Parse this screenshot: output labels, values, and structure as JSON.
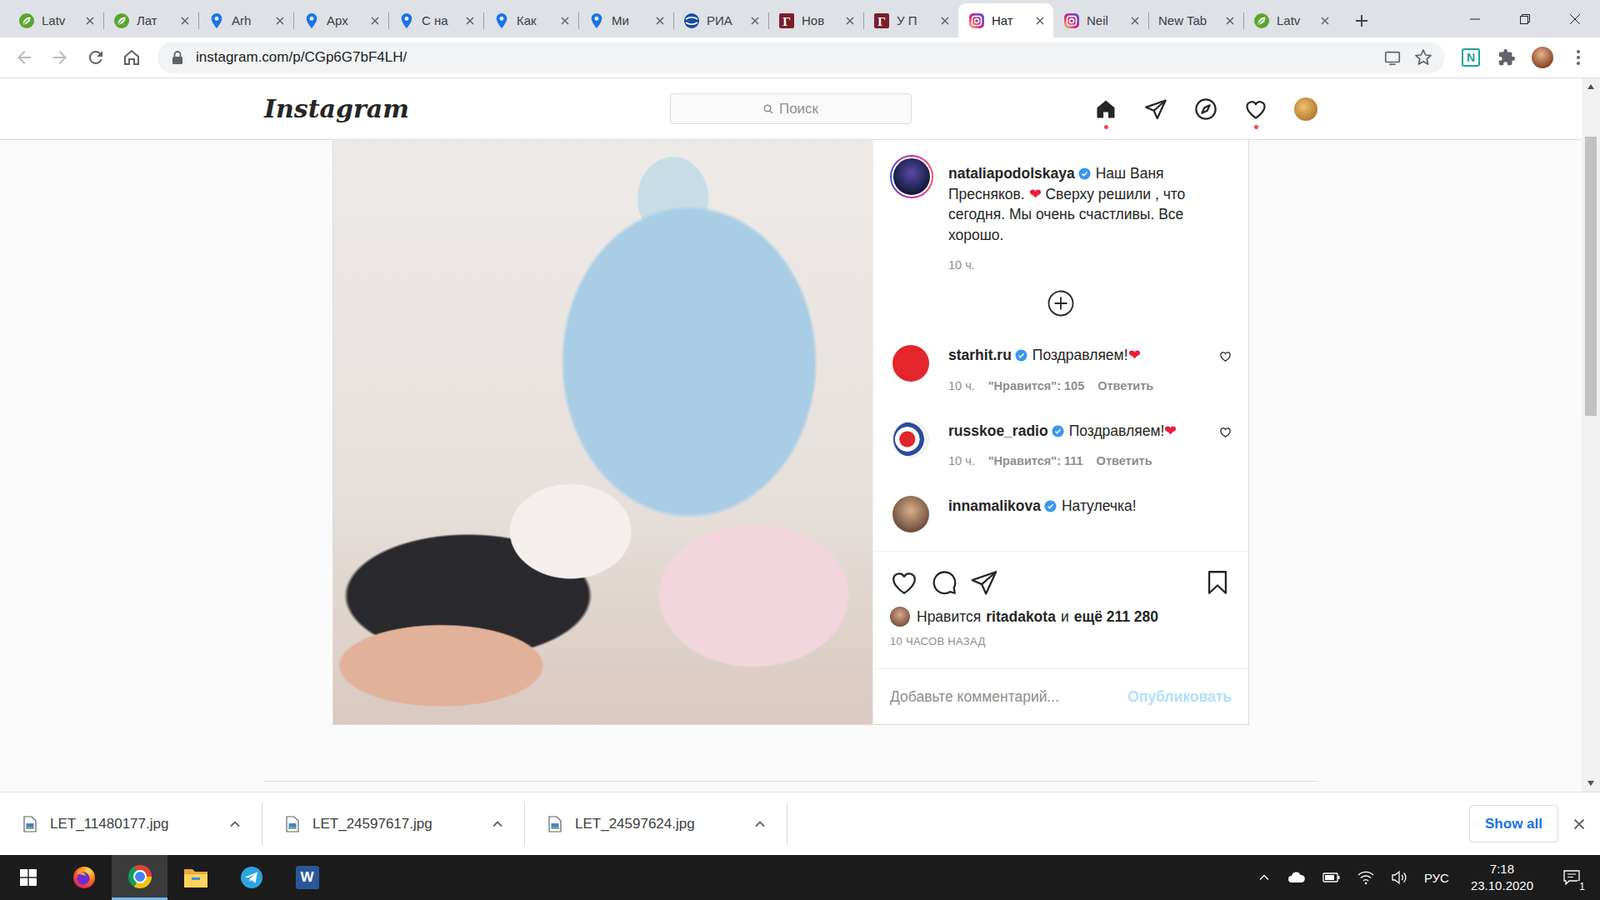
{
  "browser": {
    "tabs": [
      {
        "label": "Latv",
        "kind": "leaf",
        "selected": false
      },
      {
        "label": "Лат",
        "kind": "leaf",
        "selected": false
      },
      {
        "label": "Arh",
        "kind": "pin",
        "selected": false
      },
      {
        "label": "Арх",
        "kind": "pin",
        "selected": false
      },
      {
        "label": "С на",
        "kind": "pin",
        "selected": false
      },
      {
        "label": "Как",
        "kind": "pin",
        "selected": false
      },
      {
        "label": "Ми",
        "kind": "pin",
        "selected": false
      },
      {
        "label": "РИА",
        "kind": "ria",
        "selected": false
      },
      {
        "label": "Нов",
        "kind": "letter",
        "favicon_text": "Г",
        "selected": false
      },
      {
        "label": "У П",
        "kind": "letter",
        "favicon_text": "Г",
        "selected": false
      },
      {
        "label": "Нат",
        "kind": "instagram",
        "selected": true
      },
      {
        "label": "Neil",
        "kind": "instagram",
        "selected": false
      },
      {
        "label": "New Tab",
        "kind": "blank",
        "selected": false
      },
      {
        "label": "Latv",
        "kind": "leaf",
        "selected": false
      }
    ],
    "url": "instagram.com/p/CGp6G7bF4LH/",
    "extension_label": "N"
  },
  "instagram": {
    "logo": "Instagram",
    "search_placeholder": "Поиск",
    "nav": [
      {
        "kind": "home",
        "dot": true
      },
      {
        "kind": "direct",
        "dot": false
      },
      {
        "kind": "explore",
        "dot": false
      },
      {
        "kind": "activity",
        "dot": true
      },
      {
        "kind": "profile",
        "dot": false
      }
    ]
  },
  "post": {
    "author": "nataliapodolskaya",
    "author_verified": true,
    "caption": [
      {
        "kind": "text",
        "text": "Наш Ваня Пресняков. "
      },
      {
        "kind": "emoji",
        "text": "❤"
      },
      {
        "kind": "text",
        "text": " Сверху решили , что сегодня. Мы очень счастливы. Все хорошо."
      }
    ],
    "caption_time": "10 ч.",
    "comments": [
      {
        "user": "starhit.ru",
        "verified": true,
        "text": "Поздравляем!",
        "emoji": "❤",
        "time": "10 ч.",
        "likes": "\"Нравится\": 105",
        "reply": "Ответить",
        "liked": false
      },
      {
        "user": "russkoe_radio",
        "verified": true,
        "text": "Поздравляем!",
        "emoji": "❤",
        "time": "10 ч.",
        "likes": "\"Нравится\": 111",
        "reply": "Ответить",
        "liked": false
      },
      {
        "user": "innamalikova",
        "verified": true,
        "text": "Натулечка!"
      }
    ],
    "liked": false,
    "saved": false,
    "likes": {
      "prefix": "Нравится",
      "user": "ritadakota",
      "joiner": "и",
      "others": "ещё 211 280"
    },
    "date": "10 ЧАСОВ НАЗАД",
    "comment_placeholder": "Добавьте комментарий...",
    "publish": {
      "label": "Опубликовать",
      "disabled": true
    }
  },
  "downloads": {
    "files": [
      "LET_11480177.jpg",
      "LET_24597617.jpg",
      "LET_24597624.jpg"
    ],
    "show_all": "Show all"
  },
  "taskbar": {
    "apps": [
      {
        "kind": "firefox",
        "active": false
      },
      {
        "kind": "chrome",
        "active": true
      },
      {
        "kind": "explorer",
        "active": false
      },
      {
        "kind": "telegram",
        "active": false
      },
      {
        "kind": "word",
        "active": false,
        "label": "W"
      }
    ],
    "language": "РУС",
    "time": "7:18",
    "date": "23.10.2020",
    "notifications": "1"
  }
}
